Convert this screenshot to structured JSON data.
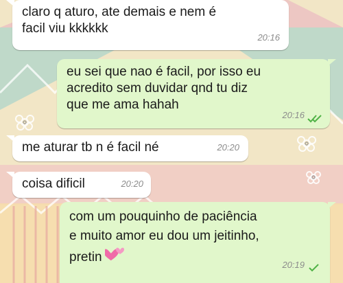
{
  "colors": {
    "incoming_bubble": "#ffffff",
    "outgoing_bubble": "#e1f7cb",
    "timestamp": "#8c8c8c",
    "read_ticks": "#4fb246",
    "wallpaper_base": "#f2e6c6",
    "wallpaper_teal": "#b9d7c9",
    "wallpaper_pink": "#ecc3c2"
  },
  "messages": [
    {
      "direction": "incoming",
      "text": "claro q aturo, ate demais e nem é\nfacil viu kkkkkk",
      "time": "20:16"
    },
    {
      "direction": "outgoing",
      "text": "eu sei que nao é facil, por isso eu\nacredito sem duvidar qnd tu diz\nque me ama hahah",
      "time": "20:16",
      "status_icon": "double-check-icon"
    },
    {
      "direction": "incoming",
      "text": "me aturar tb n é facil né",
      "time": "20:20"
    },
    {
      "direction": "incoming",
      "text": "coisa dificil",
      "time": "20:20"
    },
    {
      "direction": "outgoing",
      "text": "com um pouquinho de paciência\ne muito amor eu dou um jeitinho,\npretin",
      "emoji": "two-hearts-icon",
      "time": "20:19",
      "status_icon": "single-check-icon"
    }
  ]
}
